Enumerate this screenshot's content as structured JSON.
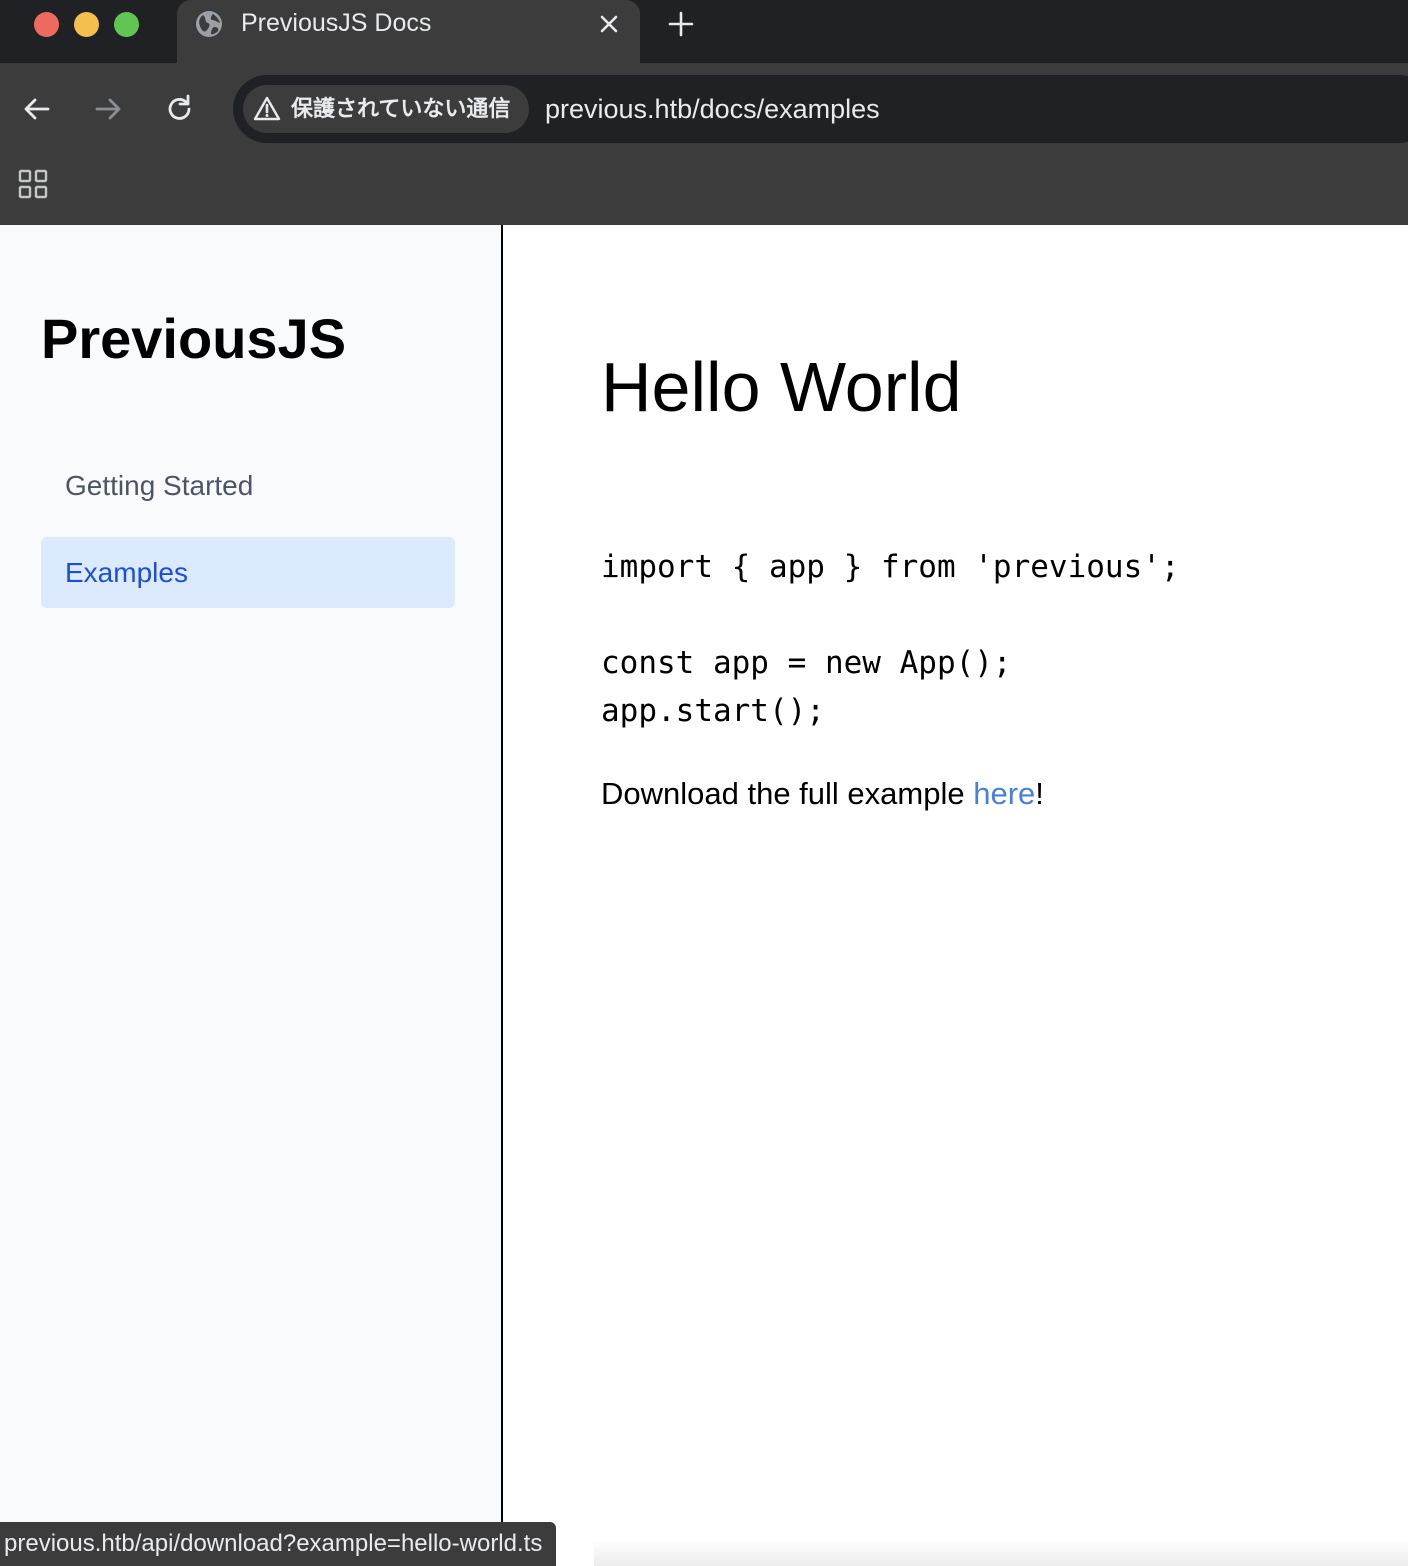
{
  "browser": {
    "tab": {
      "title": "PreviousJS Docs",
      "favicon": "globe-icon"
    },
    "toolbar": {
      "security_label": "保護されていない通信",
      "url": "previous.htb/docs/examples"
    },
    "status_url": "previous.htb/api/download?example=hello-world.ts"
  },
  "sidebar": {
    "brand": "PreviousJS",
    "items": [
      {
        "label": "Getting Started",
        "active": false
      },
      {
        "label": "Examples",
        "active": true
      }
    ]
  },
  "main": {
    "heading": "Hello World",
    "code": "import { app } from 'previous';\n\nconst app = new App();\napp.start();",
    "download_prefix": "Download the full example ",
    "download_link": "here",
    "download_suffix": "!"
  },
  "colors": {
    "chrome_dark": "#202124",
    "chrome_mid": "#3c3c3c",
    "sidebar_bg": "#f8fafc",
    "active_bg": "#dbeafe",
    "active_text": "#1d4ed8",
    "link": "#4a7fd8"
  }
}
